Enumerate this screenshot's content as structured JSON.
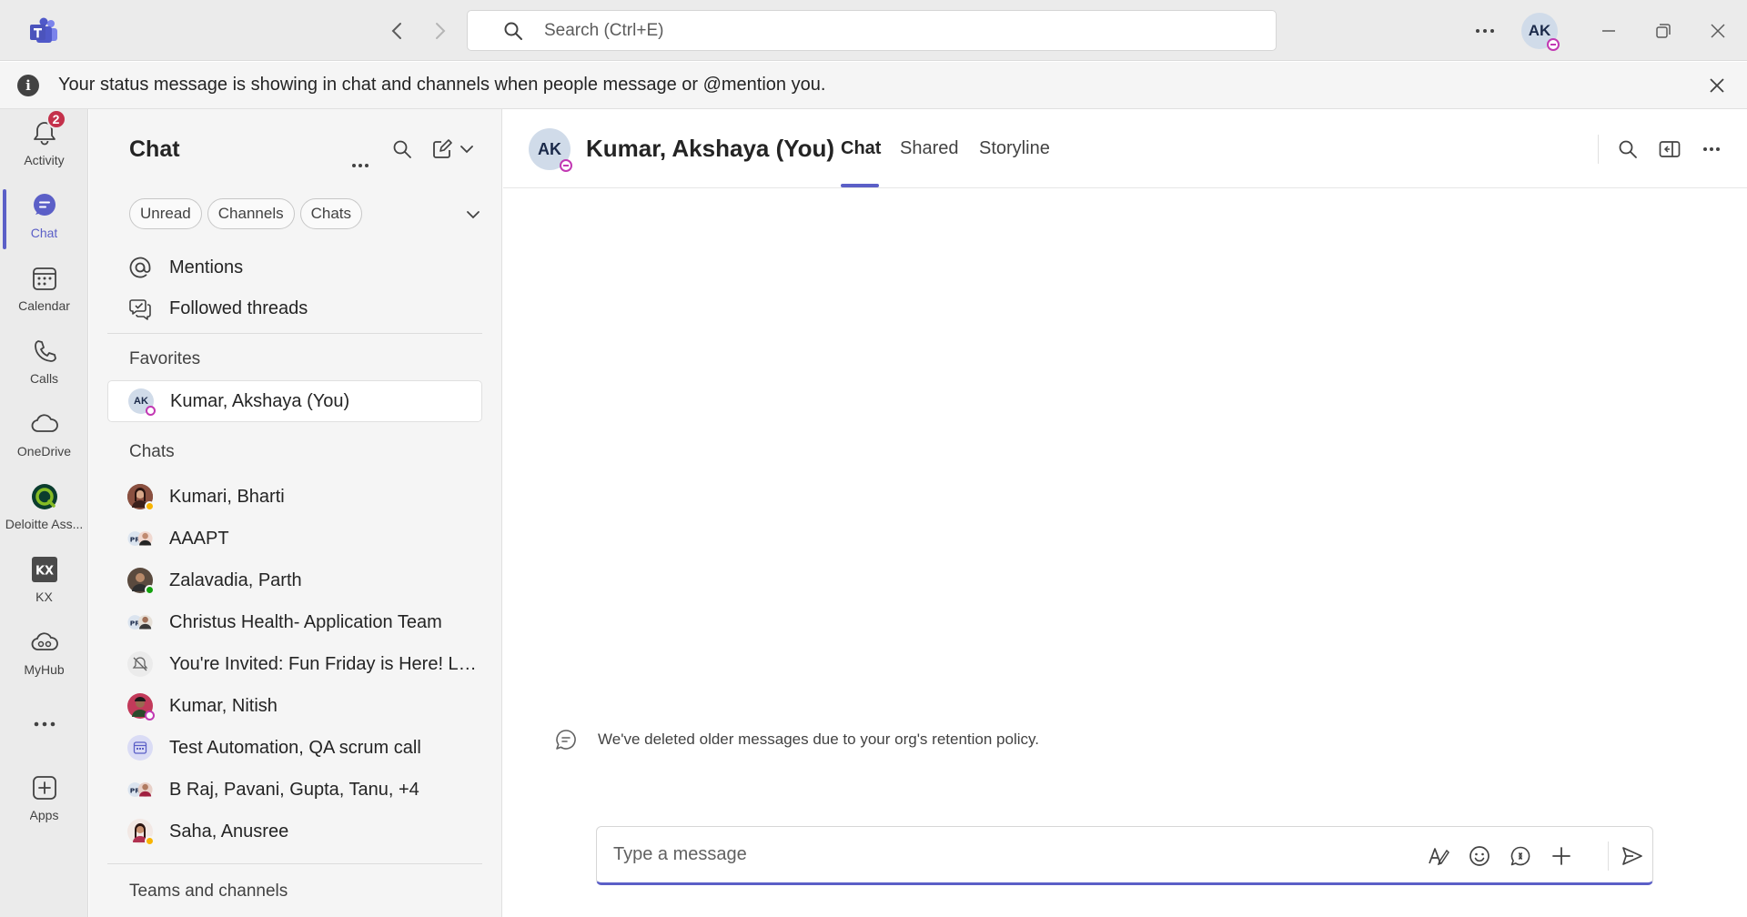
{
  "titlebar": {
    "search_placeholder": "Search (Ctrl+E)",
    "user_initials": "AK"
  },
  "banner": {
    "message": "Your status message is showing in chat and channels when people message or @mention you."
  },
  "rail": {
    "items": [
      {
        "label": "Activity",
        "icon": "bell-icon",
        "badge": "2"
      },
      {
        "label": "Chat",
        "icon": "chat-icon"
      },
      {
        "label": "Calendar",
        "icon": "calendar-icon"
      },
      {
        "label": "Calls",
        "icon": "phone-icon"
      },
      {
        "label": "OneDrive",
        "icon": "cloud-icon"
      },
      {
        "label": "Deloitte Ass...",
        "icon": "deloitte-icon"
      },
      {
        "label": "KX",
        "icon": "kx-icon"
      },
      {
        "label": "MyHub",
        "icon": "myhub-icon"
      },
      {
        "label": "",
        "icon": "more-icon"
      },
      {
        "label": "Apps",
        "icon": "add-app-icon"
      }
    ]
  },
  "chat_list": {
    "title": "Chat",
    "filters": [
      "Unread",
      "Channels",
      "Chats"
    ],
    "quick_links": [
      "Mentions",
      "Followed threads"
    ],
    "favorites_header": "Favorites",
    "favorites": [
      {
        "name": "Kumar, Akshaya (You)",
        "initials": "AK"
      }
    ],
    "chats_header": "Chats",
    "chats": [
      {
        "name": "Kumari, Bharti"
      },
      {
        "name": "AAAPT"
      },
      {
        "name": "Zalavadia, Parth"
      },
      {
        "name": "Christus Health- Application Team"
      },
      {
        "name": "You're Invited: Fun Friday is Here! Let..."
      },
      {
        "name": "Kumar, Nitish"
      },
      {
        "name": "Test Automation, QA scrum call"
      },
      {
        "name": "B Raj, Pavani, Gupta, Tanu, +4"
      },
      {
        "name": "Saha, Anusree"
      }
    ],
    "teams_header": "Teams and channels"
  },
  "conversation": {
    "avatar_initials": "AK",
    "title": "Kumar, Akshaya (You)",
    "tabs": [
      "Chat",
      "Shared",
      "Storyline"
    ],
    "retention_notice": "We've deleted older messages due to your org's retention policy.",
    "composer_placeholder": "Type a message"
  },
  "colors": {
    "accent": "#5b5fc7",
    "badge": "#c4314b",
    "away": "#f8b400",
    "available": "#13a10e",
    "out_of_office": "#c239b3"
  }
}
